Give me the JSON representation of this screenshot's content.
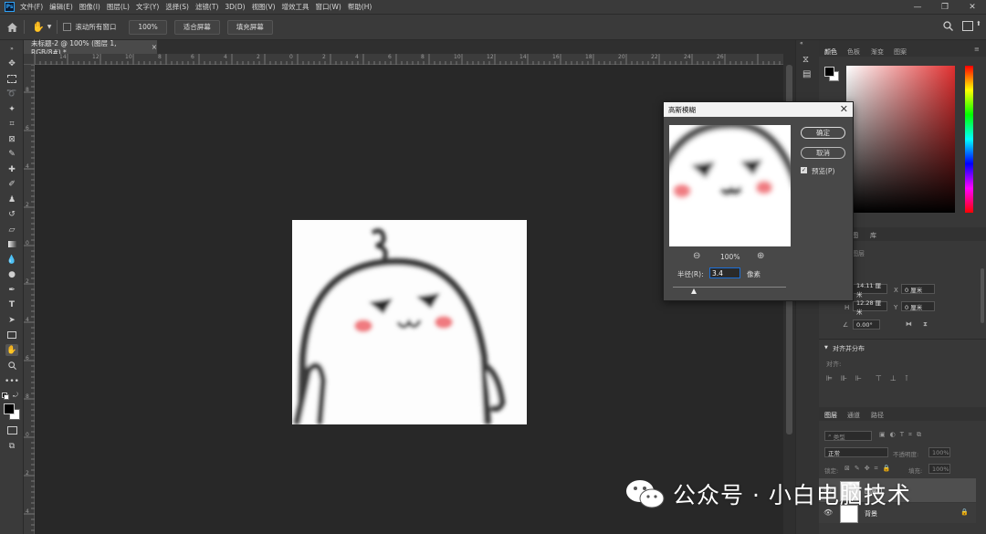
{
  "app": {
    "logo": "Ps",
    "menus": [
      "文件(F)",
      "编辑(E)",
      "图像(I)",
      "图层(L)",
      "文字(Y)",
      "选择(S)",
      "滤镜(T)",
      "3D(D)",
      "视图(V)",
      "增效工具",
      "窗口(W)",
      "帮助(H)"
    ]
  },
  "options_bar": {
    "scroll_all_label": "滚动所有窗口",
    "zoom_value": "100%",
    "fit_screen_label": "适合屏幕",
    "fill_screen_label": "填充屏幕"
  },
  "document": {
    "tab_title": "未标题-2 @ 100% (图层 1, RGB/8#) *",
    "close_glyph": "×"
  },
  "ruler": {
    "top": [
      "14",
      "12",
      "10",
      "8",
      "6",
      "4",
      "2",
      "0",
      "2",
      "4",
      "6",
      "8",
      "10",
      "12",
      "14",
      "16",
      "18",
      "20",
      "22",
      "24",
      "26"
    ],
    "left": [
      "8",
      "6",
      "4",
      "2",
      "0",
      "2",
      "4",
      "6",
      "8",
      "0",
      "2",
      "4"
    ]
  },
  "dialog": {
    "title": "高斯模糊",
    "close_glyph": "✕",
    "ok_label": "确定",
    "cancel_label": "取消",
    "preview_label": "预览(P)",
    "zoom_out_glyph": "⊖",
    "zoom_in_glyph": "⊕",
    "zoom_level": "100%",
    "radius_label": "半径(R):",
    "radius_value": "3.4",
    "radius_unit": "像素"
  },
  "color_panel": {
    "tabs": [
      "颜色",
      "色板",
      "渐变",
      "图案"
    ],
    "hue_accent": "#e03030"
  },
  "properties_panel": {
    "tabs": [
      "图",
      "库"
    ],
    "header": "图层",
    "w_label": "W",
    "w_value": "14.11 厘米",
    "h_label": "H",
    "h_value": "12.28 厘米",
    "x_label": "X",
    "x_value": "0 厘米",
    "y_label": "Y",
    "y_value": "0 厘米",
    "angle_value": "0.00°",
    "align_title": "对齐并分布",
    "align_sub": "对齐:"
  },
  "layers_panel": {
    "tabs": [
      "图层",
      "通道",
      "路径"
    ],
    "search_placeholder": "类型",
    "blend_mode": "正常",
    "opacity_label": "不透明度:",
    "opacity_value": "100%",
    "lock_label": "锁定:",
    "fill_label": "填充:",
    "fill_value": "100%",
    "layers": [
      {
        "name": "图层 1"
      },
      {
        "name": "背景"
      }
    ]
  },
  "watermark": {
    "text": "公众号 · 小白电脑技术"
  }
}
